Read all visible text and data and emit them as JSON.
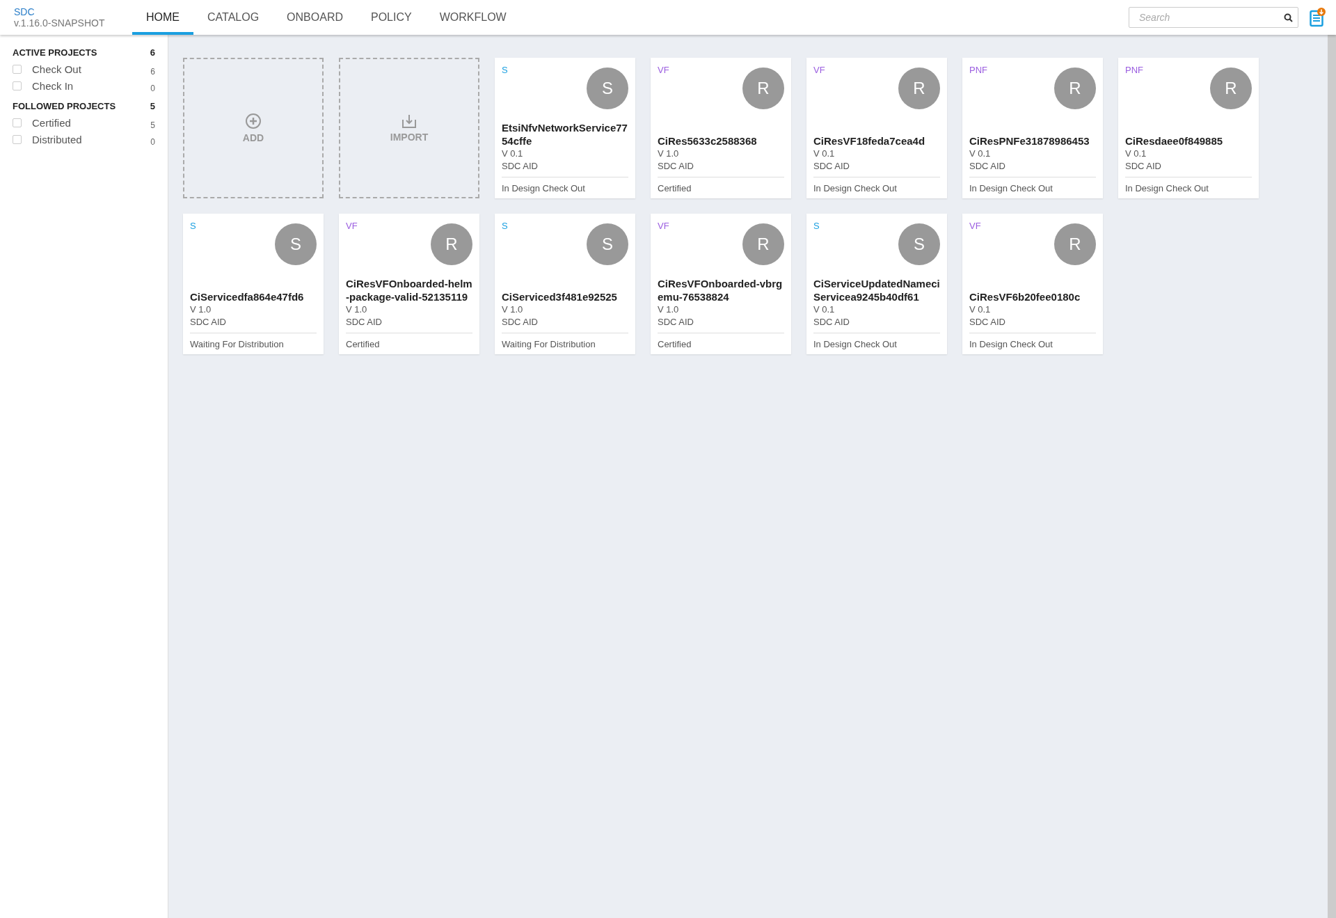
{
  "header": {
    "brand": "SDC",
    "version": "v.1.16.0-SNAPSHOT",
    "tabs": [
      {
        "label": "HOME",
        "selected": true
      },
      {
        "label": "CATALOG",
        "selected": false
      },
      {
        "label": "ONBOARD",
        "selected": false
      },
      {
        "label": "POLICY",
        "selected": false
      },
      {
        "label": "WORKFLOW",
        "selected": false
      }
    ],
    "search": {
      "placeholder": "Search"
    }
  },
  "sidebar": {
    "groups": [
      {
        "title": "ACTIVE PROJECTS",
        "count": "6",
        "items": [
          {
            "label": "Check Out",
            "count": "6",
            "checked": false
          },
          {
            "label": "Check In",
            "count": "0",
            "checked": false
          }
        ]
      },
      {
        "title": "FOLLOWED PROJECTS",
        "count": "5",
        "items": [
          {
            "label": "Certified",
            "count": "5",
            "checked": false
          },
          {
            "label": "Distributed",
            "count": "0",
            "checked": false
          }
        ]
      }
    ]
  },
  "actions": [
    {
      "kind": "add",
      "label": "ADD"
    },
    {
      "kind": "import",
      "label": "IMPORT"
    }
  ],
  "cards": [
    {
      "type": "S",
      "color": "#1a9fe0",
      "avatar": "S",
      "name": "EtsiNfvNetworkService7754cffe",
      "version": "V 0.1",
      "owner": "SDC AID",
      "status": "In Design Check Out"
    },
    {
      "type": "VF",
      "color": "#9b5ee0",
      "avatar": "R",
      "name": "CiRes5633c2588368",
      "version": "V 1.0",
      "owner": "SDC AID",
      "status": "Certified"
    },
    {
      "type": "VF",
      "color": "#9b5ee0",
      "avatar": "R",
      "name": "CiResVF18feda7cea4d",
      "version": "V 0.1",
      "owner": "SDC AID",
      "status": "In Design Check Out"
    },
    {
      "type": "PNF",
      "color": "#9b5ee0",
      "avatar": "R",
      "name": "CiResPNFe31878986453",
      "version": "V 0.1",
      "owner": "SDC AID",
      "status": "In Design Check Out"
    },
    {
      "type": "PNF",
      "color": "#9b5ee0",
      "avatar": "R",
      "name": "CiResdaee0f849885",
      "version": "V 0.1",
      "owner": "SDC AID",
      "status": "In Design Check Out"
    },
    {
      "type": "S",
      "color": "#1a9fe0",
      "avatar": "S",
      "name": "CiServicedfa864e47fd6",
      "version": "V 1.0",
      "owner": "SDC AID",
      "status": "Waiting For Distribution"
    },
    {
      "type": "VF",
      "color": "#9b5ee0",
      "avatar": "R",
      "name": "CiResVFOnboarded-helm-package-valid-52135119",
      "version": "V 1.0",
      "owner": "SDC AID",
      "status": "Certified"
    },
    {
      "type": "S",
      "color": "#1a9fe0",
      "avatar": "S",
      "name": "CiServiced3f481e92525",
      "version": "V 1.0",
      "owner": "SDC AID",
      "status": "Waiting For Distribution"
    },
    {
      "type": "VF",
      "color": "#9b5ee0",
      "avatar": "R",
      "name": "CiResVFOnboarded-vbrgemu-76538824",
      "version": "V 1.0",
      "owner": "SDC AID",
      "status": "Certified"
    },
    {
      "type": "S",
      "color": "#1a9fe0",
      "avatar": "S",
      "name": "CiServiceUpdatedNameciServicea9245b40df61",
      "version": "V 0.1",
      "owner": "SDC AID",
      "status": "In Design Check Out"
    },
    {
      "type": "VF",
      "color": "#9b5ee0",
      "avatar": "R",
      "name": "CiResVF6b20fee0180c",
      "version": "V 0.1",
      "owner": "SDC AID",
      "status": "In Design Check Out"
    }
  ]
}
